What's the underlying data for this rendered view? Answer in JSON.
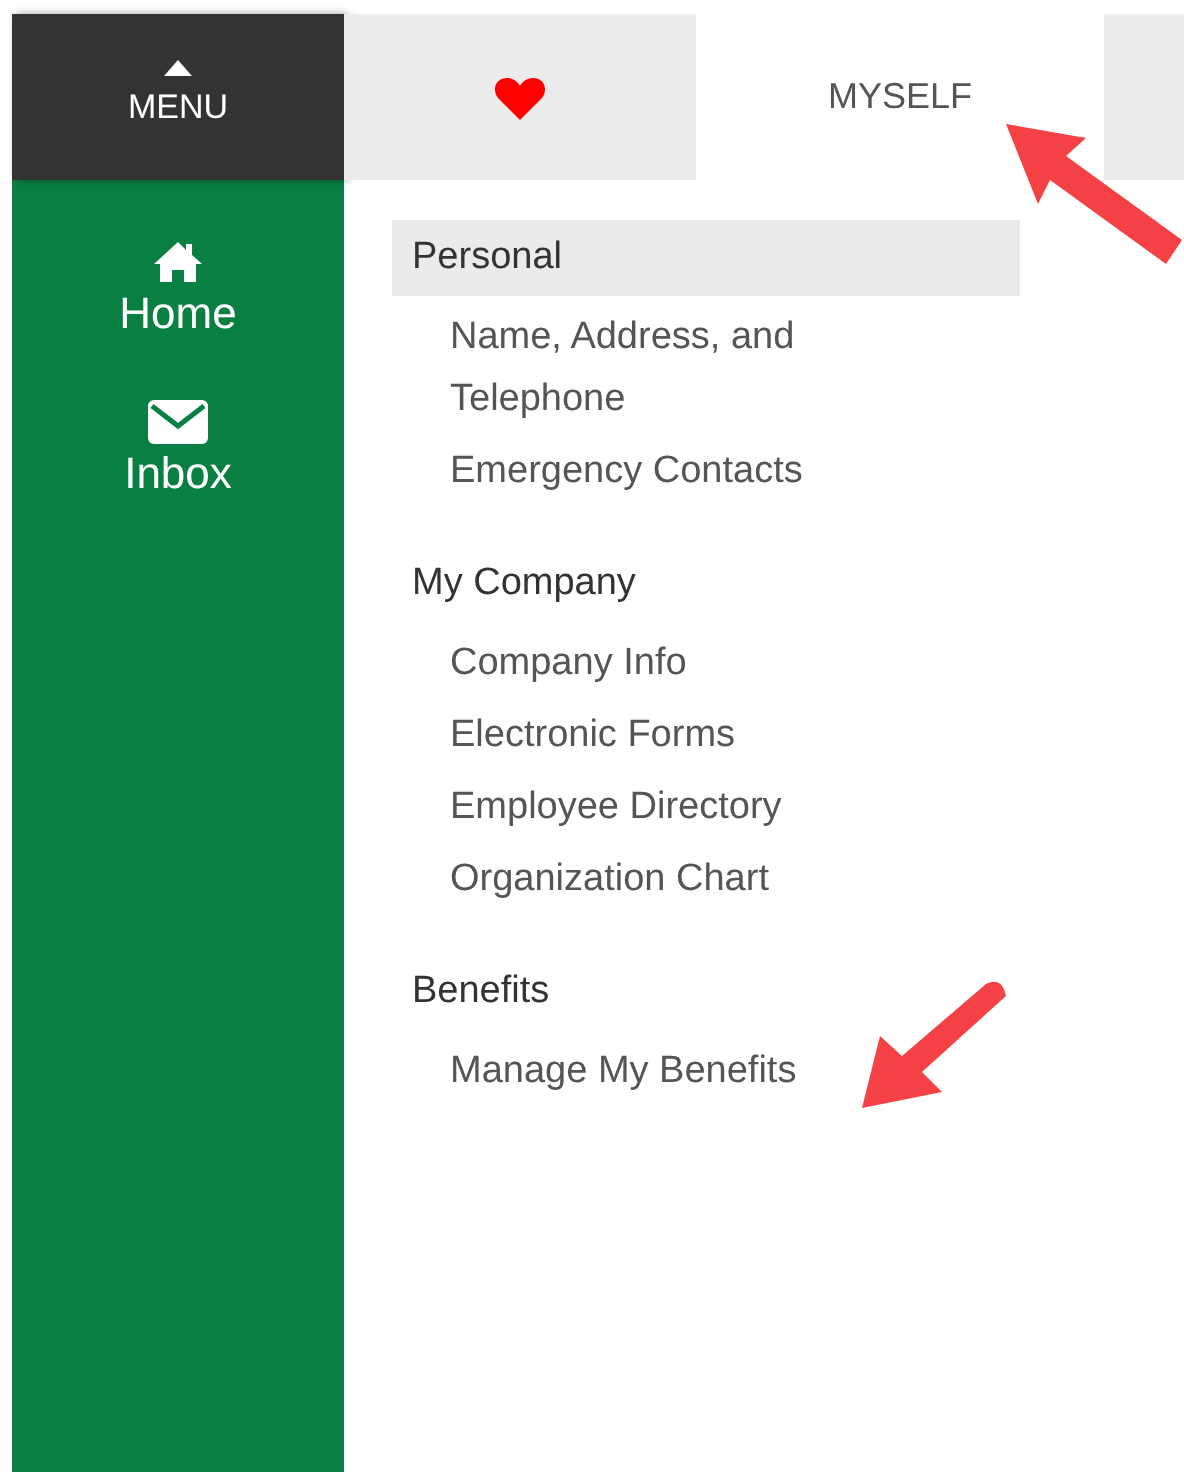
{
  "sidebar": {
    "menu_label": "MENU",
    "items": [
      {
        "kind": "home",
        "label": "Home"
      },
      {
        "kind": "inbox",
        "label": "Inbox"
      }
    ]
  },
  "tabs": [
    {
      "kind": "heart",
      "selected": false
    },
    {
      "kind": "text",
      "label": "MYSELF",
      "selected": true
    },
    {
      "kind": "blank",
      "selected": false
    }
  ],
  "sections": [
    {
      "heading": "Personal",
      "highlighted": true,
      "items": [
        "Name, Address, and Telephone",
        "Emergency Contacts"
      ]
    },
    {
      "heading": "My Company",
      "highlighted": false,
      "items": [
        "Company Info",
        "Electronic Forms",
        "Employee Directory",
        "Organization Chart"
      ]
    },
    {
      "heading": "Benefits",
      "highlighted": false,
      "items": [
        "Manage My Benefits"
      ]
    }
  ]
}
